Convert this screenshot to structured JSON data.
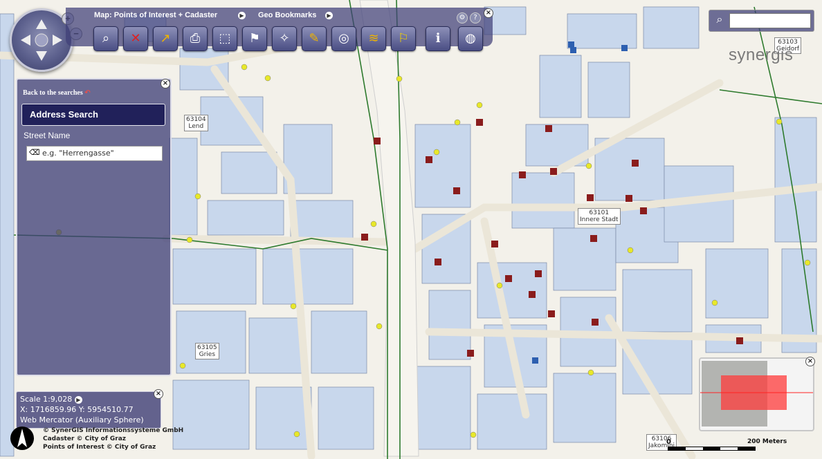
{
  "toolbar": {
    "menu_map": "Map: Points of Interest + Cadaster",
    "menu_bookmarks": "Geo Bookmarks",
    "tools": [
      {
        "icon": "binoculars-icon"
      },
      {
        "icon": "clear-selection-icon"
      },
      {
        "icon": "chart-icon"
      },
      {
        "icon": "print-icon"
      },
      {
        "icon": "map-export-icon"
      },
      {
        "icon": "language-flag-icon"
      },
      {
        "icon": "compass-icon"
      },
      {
        "icon": "pencil-icon"
      },
      {
        "icon": "zoom-search-icon"
      },
      {
        "icon": "map-layers-icon"
      },
      {
        "icon": "flag-icon"
      },
      {
        "icon": "info-icon"
      },
      {
        "icon": "globe-window-icon"
      }
    ]
  },
  "panel": {
    "back_label": "Back to the searches",
    "title": "Address Search",
    "street_label": "Street Name",
    "street_placeholder": "e.g. \"Herrengasse\""
  },
  "scale": {
    "scale_text": "Scale 1:9,028",
    "coords": "X: 1716859.96 Y: 5954510.77",
    "projection": "Web Mercator (Auxiliary Sphere)"
  },
  "credits": {
    "line1": "© SynerGIS Informationssysteme GmbH",
    "line2": "Cadaster © City of Graz",
    "line3": "Points of Interest © City of Graz"
  },
  "scalebar": {
    "zero": "0",
    "label": "200 Meters"
  },
  "logo": {
    "text": "synergis"
  },
  "districts": [
    {
      "code": "63104",
      "name": "Lend"
    },
    {
      "code": "63101",
      "name": "Innere Stadt"
    },
    {
      "code": "63105",
      "name": "Gries"
    },
    {
      "code": "63103",
      "name": "Geidorf"
    },
    {
      "code": "63106",
      "name": "Jakomini"
    }
  ],
  "colors": {
    "panel": "#3e3e76",
    "building": "#c6d6ec",
    "street": "#ece8dd",
    "accent": "#21215a"
  }
}
